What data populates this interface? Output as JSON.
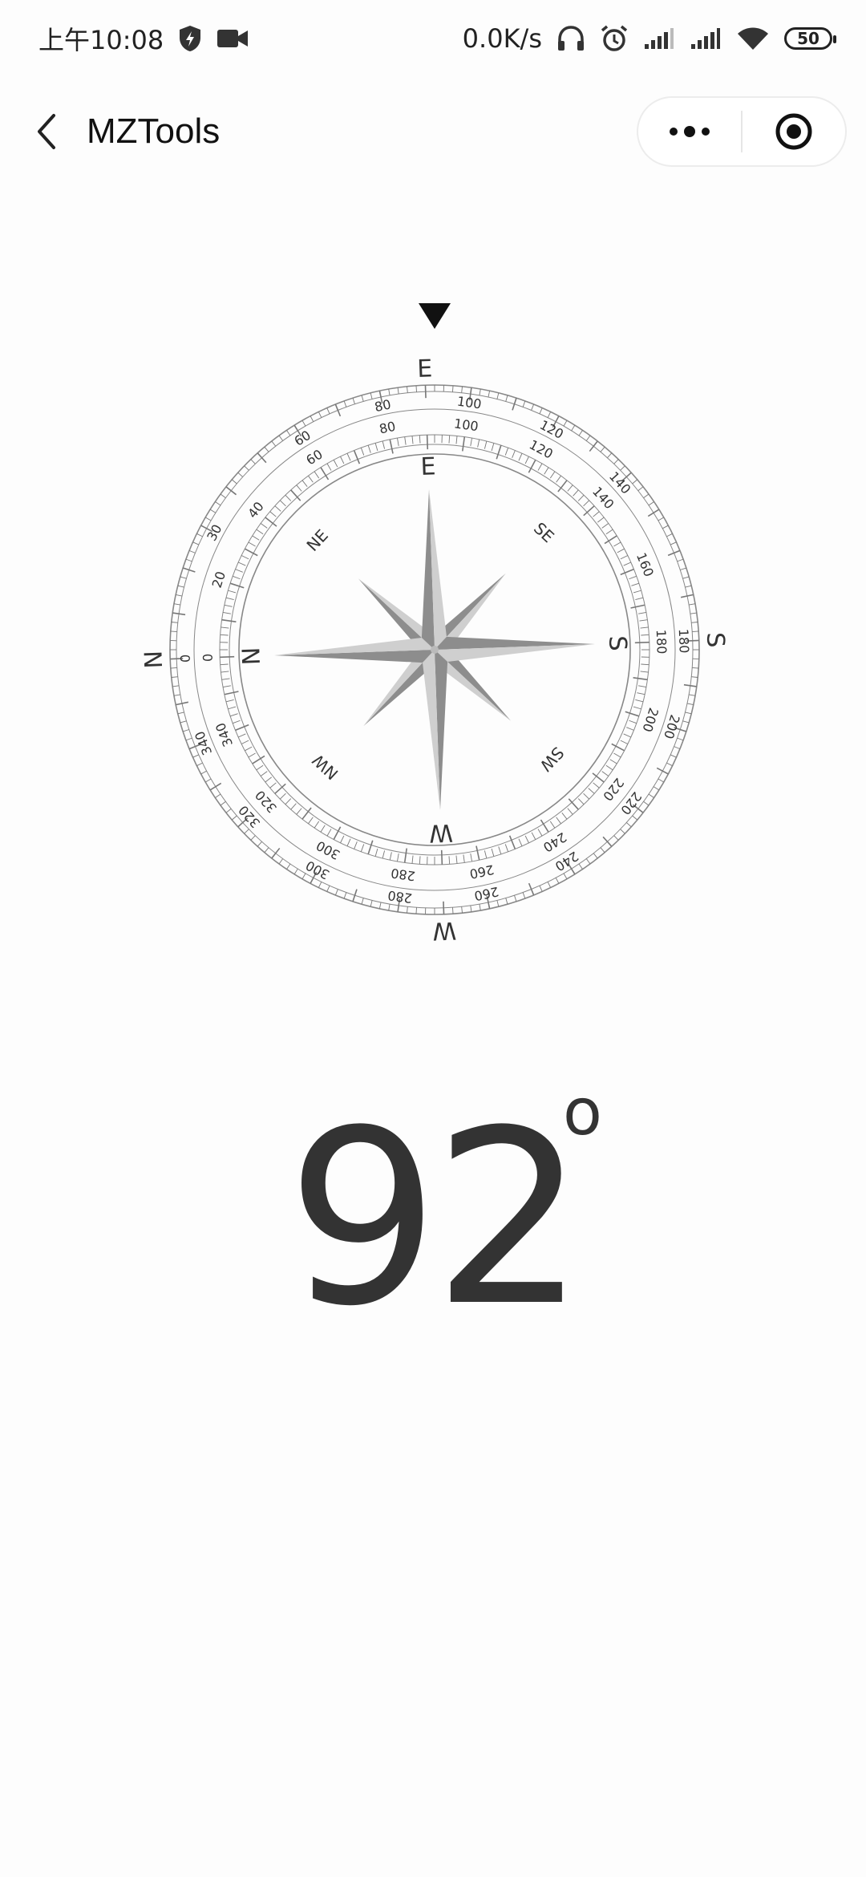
{
  "status_bar": {
    "time": "上午10:08",
    "speed": "0.0K/s",
    "battery": "50",
    "icons": [
      "shield-icon",
      "video-camera-icon",
      "headphones-icon",
      "alarm-icon",
      "signal-icon",
      "signal-icon",
      "wifi-icon"
    ]
  },
  "title_bar": {
    "title": "MZTools",
    "back_icon": "chevron-left-icon",
    "menu_icon": "more-dots-icon",
    "close_icon": "target-close-icon"
  },
  "compass": {
    "heading_degrees": 92,
    "pointer_icon": "triangle-down-icon",
    "outer_cardinals": [
      "E",
      "S",
      "W",
      "N"
    ],
    "inner_cardinals": [
      "E",
      "S",
      "W",
      "N"
    ],
    "intercardinals": [
      "NE",
      "SE",
      "SW",
      "NW"
    ],
    "outer_labels": [
      "0",
      "30",
      "60",
      "80",
      "100",
      "120",
      "140",
      "180",
      "200",
      "220",
      "240",
      "260",
      "280",
      "300",
      "320",
      "340"
    ],
    "inner_labels": [
      "0",
      "20",
      "40",
      "60",
      "80",
      "100",
      "120",
      "140",
      "160",
      "180",
      "200",
      "220",
      "240",
      "260",
      "280",
      "300",
      "320",
      "340"
    ],
    "colors": {
      "rose_dark": "#8d8d8d",
      "rose_light": "#cfcfcf",
      "ring": "#888888"
    }
  },
  "readout": {
    "value": "92",
    "unit": "o"
  }
}
